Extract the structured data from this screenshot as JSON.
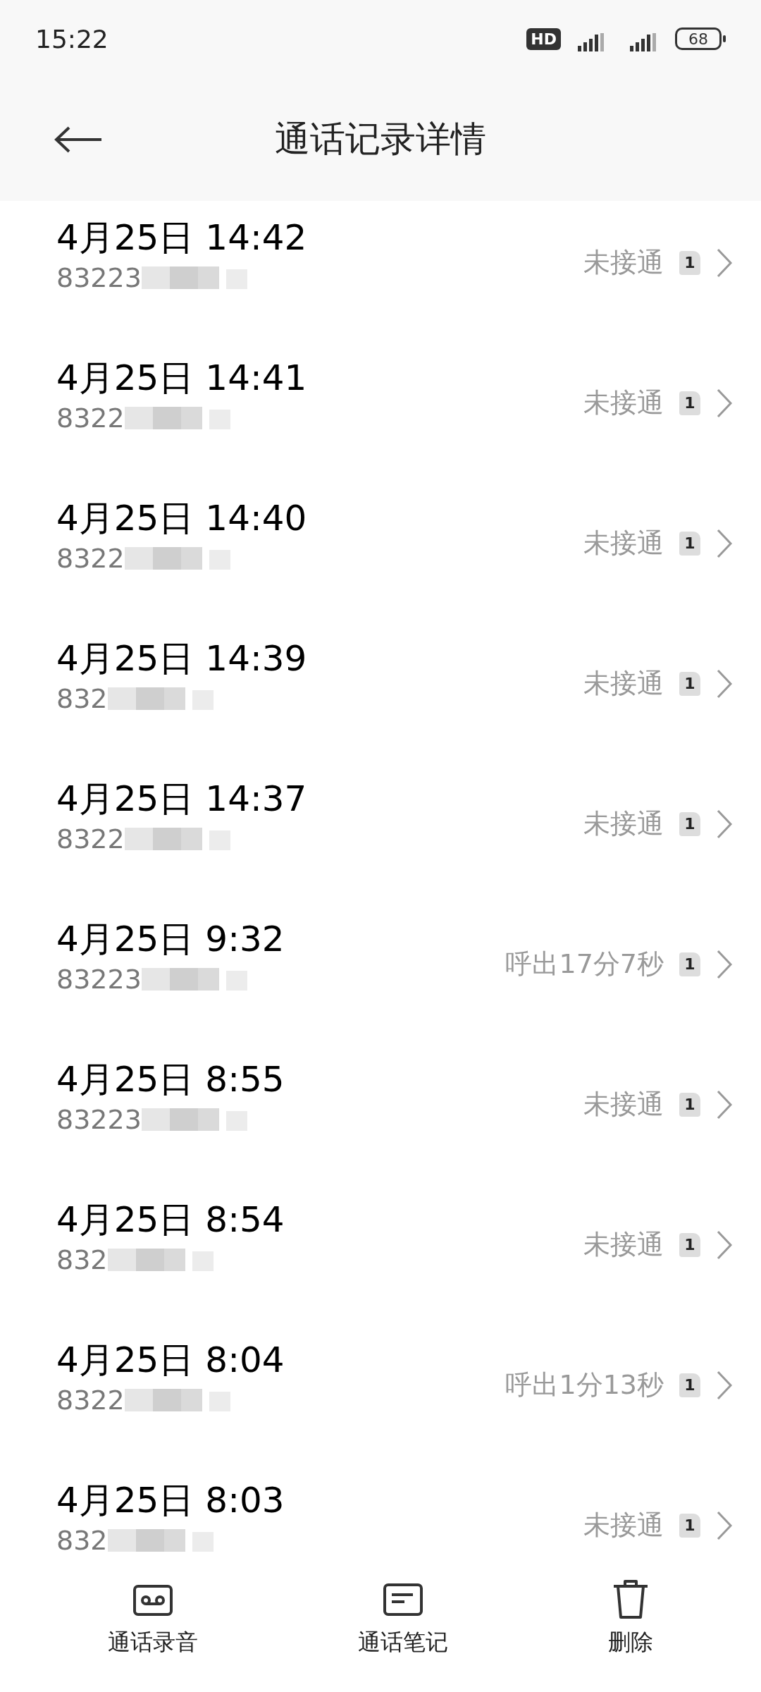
{
  "status_bar": {
    "time": "15:22",
    "hd_label": "HD",
    "battery": "68"
  },
  "header": {
    "title": "通话记录详情"
  },
  "calls": [
    {
      "datetime": "4月25日 14:42",
      "number": "83223",
      "status": "未接通",
      "sim": "1"
    },
    {
      "datetime": "4月25日 14:41",
      "number": "8322",
      "status": "未接通",
      "sim": "1"
    },
    {
      "datetime": "4月25日 14:40",
      "number": "8322",
      "status": "未接通",
      "sim": "1"
    },
    {
      "datetime": "4月25日 14:39",
      "number": "832",
      "status": "未接通",
      "sim": "1"
    },
    {
      "datetime": "4月25日 14:37",
      "number": "8322",
      "status": "未接通",
      "sim": "1"
    },
    {
      "datetime": "4月25日 9:32",
      "number": "83223",
      "status": "呼出17分7秒",
      "sim": "1"
    },
    {
      "datetime": "4月25日 8:55",
      "number": "83223",
      "status": "未接通",
      "sim": "1"
    },
    {
      "datetime": "4月25日 8:54",
      "number": "832",
      "status": "未接通",
      "sim": "1"
    },
    {
      "datetime": "4月25日 8:04",
      "number": "8322",
      "status": "呼出1分13秒",
      "sim": "1"
    },
    {
      "datetime": "4月25日 8:03",
      "number": "832",
      "status": "未接通",
      "sim": "1"
    }
  ],
  "bottom_actions": [
    {
      "kind": "recording",
      "label": "通话录音"
    },
    {
      "kind": "notes",
      "label": "通话笔记"
    },
    {
      "kind": "delete",
      "label": "删除"
    }
  ]
}
